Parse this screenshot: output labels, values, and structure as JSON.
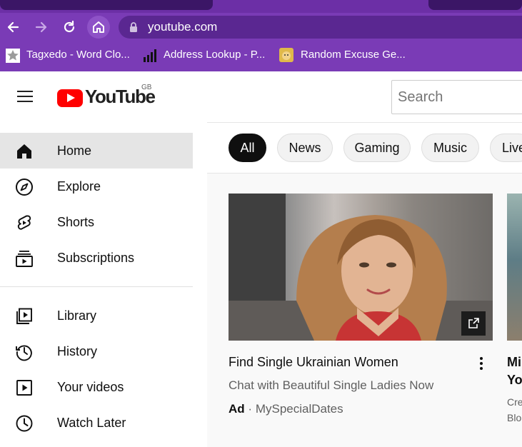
{
  "browser": {
    "url": "youtube.com",
    "bookmarks": [
      {
        "label": "Tagxedo - Word Clo..."
      },
      {
        "label": "Address Lookup - P..."
      },
      {
        "label": "Random Excuse Ge..."
      }
    ],
    "colors": {
      "theme": "#7a3bb6",
      "tabstrip": "#6c2fa6"
    }
  },
  "header": {
    "logo_text": "YouTube",
    "region": "GB",
    "search_placeholder": "Search"
  },
  "sidebar": {
    "items": [
      {
        "label": "Home",
        "icon": "home-icon",
        "active": true
      },
      {
        "label": "Explore",
        "icon": "compass-icon"
      },
      {
        "label": "Shorts",
        "icon": "shorts-icon"
      },
      {
        "label": "Subscriptions",
        "icon": "subscriptions-icon"
      },
      {
        "label": "Library",
        "icon": "library-icon"
      },
      {
        "label": "History",
        "icon": "history-icon"
      },
      {
        "label": "Your videos",
        "icon": "your-videos-icon"
      },
      {
        "label": "Watch Later",
        "icon": "clock-icon"
      }
    ]
  },
  "chips": [
    {
      "label": "All",
      "active": true
    },
    {
      "label": "News"
    },
    {
      "label": "Gaming"
    },
    {
      "label": "Music"
    },
    {
      "label": "Live"
    }
  ],
  "video": {
    "title": "Find Single Ukrainian Women",
    "subtitle": "Chat with Beautiful Single Ladies Now",
    "ad_label": "Ad",
    "separator": "·",
    "advertiser": "MySpecialDates"
  },
  "right_video": {
    "title_line1": "Mi",
    "title_line2": "Yo",
    "sub_line1": "Cre",
    "sub_line2": "Blo"
  },
  "colors": {
    "brand_red": "#ff0000",
    "active_chip": "#0f0f0f",
    "active_sidebar": "#e5e5e5"
  }
}
